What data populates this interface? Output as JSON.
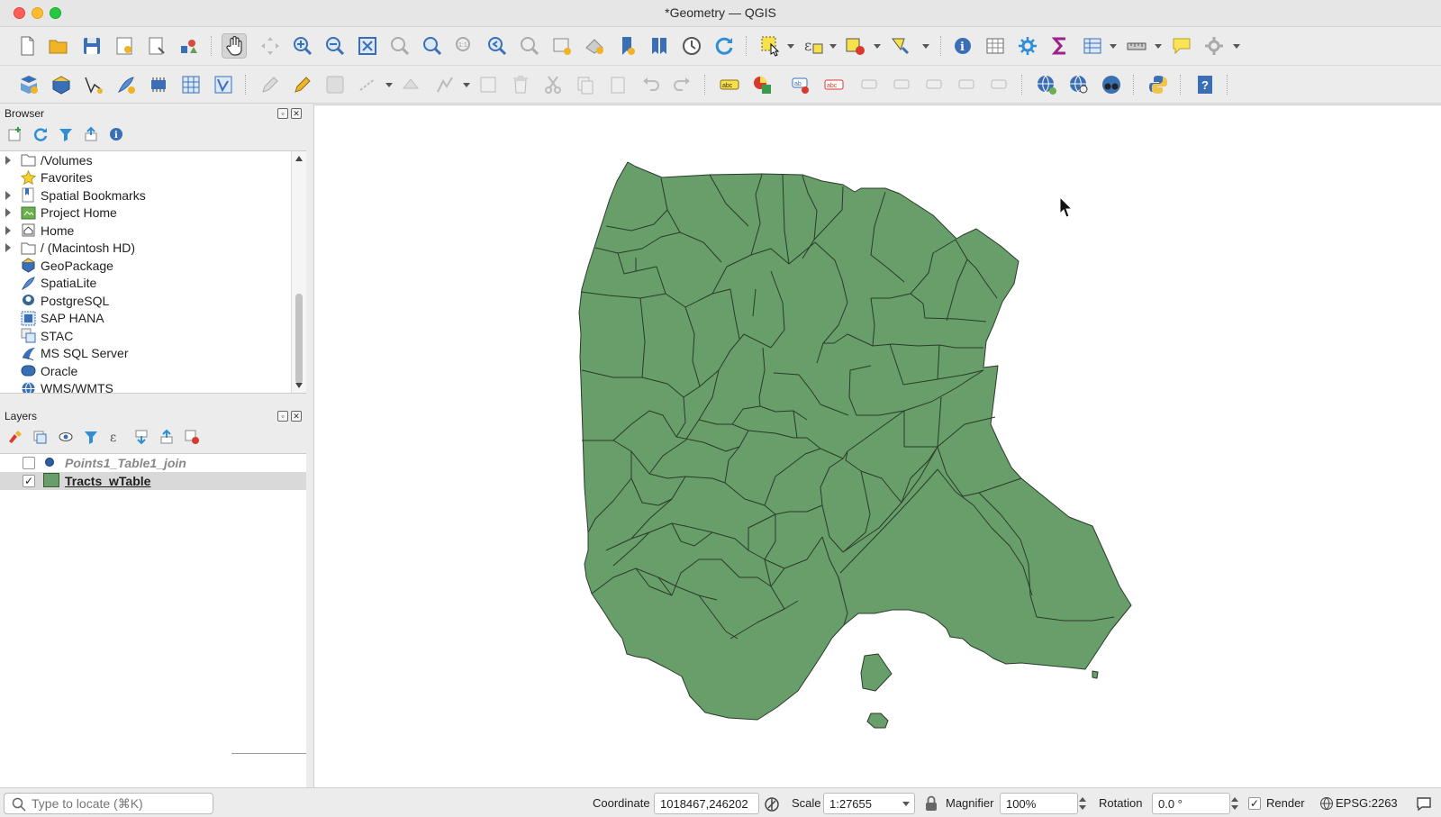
{
  "window": {
    "title": "*Geometry — QGIS"
  },
  "browser": {
    "title": "Browser",
    "items": [
      {
        "label": "/Volumes",
        "icon": "folder-icon",
        "expandable": true
      },
      {
        "label": "Favorites",
        "icon": "star-icon",
        "expandable": false
      },
      {
        "label": "Spatial Bookmarks",
        "icon": "bookmark-icon",
        "expandable": true
      },
      {
        "label": "Project Home",
        "icon": "project-home-icon",
        "expandable": true
      },
      {
        "label": "Home",
        "icon": "home-icon",
        "expandable": true
      },
      {
        "label": "/ (Macintosh HD)",
        "icon": "folder-icon",
        "expandable": true
      },
      {
        "label": "GeoPackage",
        "icon": "geopackage-icon",
        "expandable": false
      },
      {
        "label": "SpatiaLite",
        "icon": "spatialite-icon",
        "expandable": false
      },
      {
        "label": "PostgreSQL",
        "icon": "postgresql-icon",
        "expandable": false
      },
      {
        "label": "SAP HANA",
        "icon": "sap-hana-icon",
        "expandable": false
      },
      {
        "label": "STAC",
        "icon": "stac-icon",
        "expandable": false
      },
      {
        "label": "MS SQL Server",
        "icon": "mssql-icon",
        "expandable": false
      },
      {
        "label": "Oracle",
        "icon": "oracle-icon",
        "expandable": false
      },
      {
        "label": "WMS/WMTS",
        "icon": "wms-icon",
        "expandable": false
      }
    ]
  },
  "layers": {
    "title": "Layers",
    "items": [
      {
        "name": "Points1_Table1_join",
        "visible": false,
        "symbol": "point",
        "checkmark": ""
      },
      {
        "name": "Tracts_wTable",
        "visible": true,
        "symbol": "polygon",
        "checkmark": "✓"
      }
    ]
  },
  "status": {
    "locator_placeholder": "Type to locate (⌘K)",
    "coordinate_label": "Coordinate",
    "coordinate": "1018467,246202",
    "scale_label": "Scale",
    "scale": "1:27655",
    "magnifier_label": "Magnifier",
    "magnifier": "100%",
    "rotation_label": "Rotation",
    "rotation": "0.0 °",
    "render_label": "Render",
    "render_check": "✓",
    "crs": "EPSG:2263"
  },
  "colors": {
    "polygon_fill": "#689e69",
    "polygon_stroke": "#2b3a2b",
    "accent": "#2e6db4"
  }
}
